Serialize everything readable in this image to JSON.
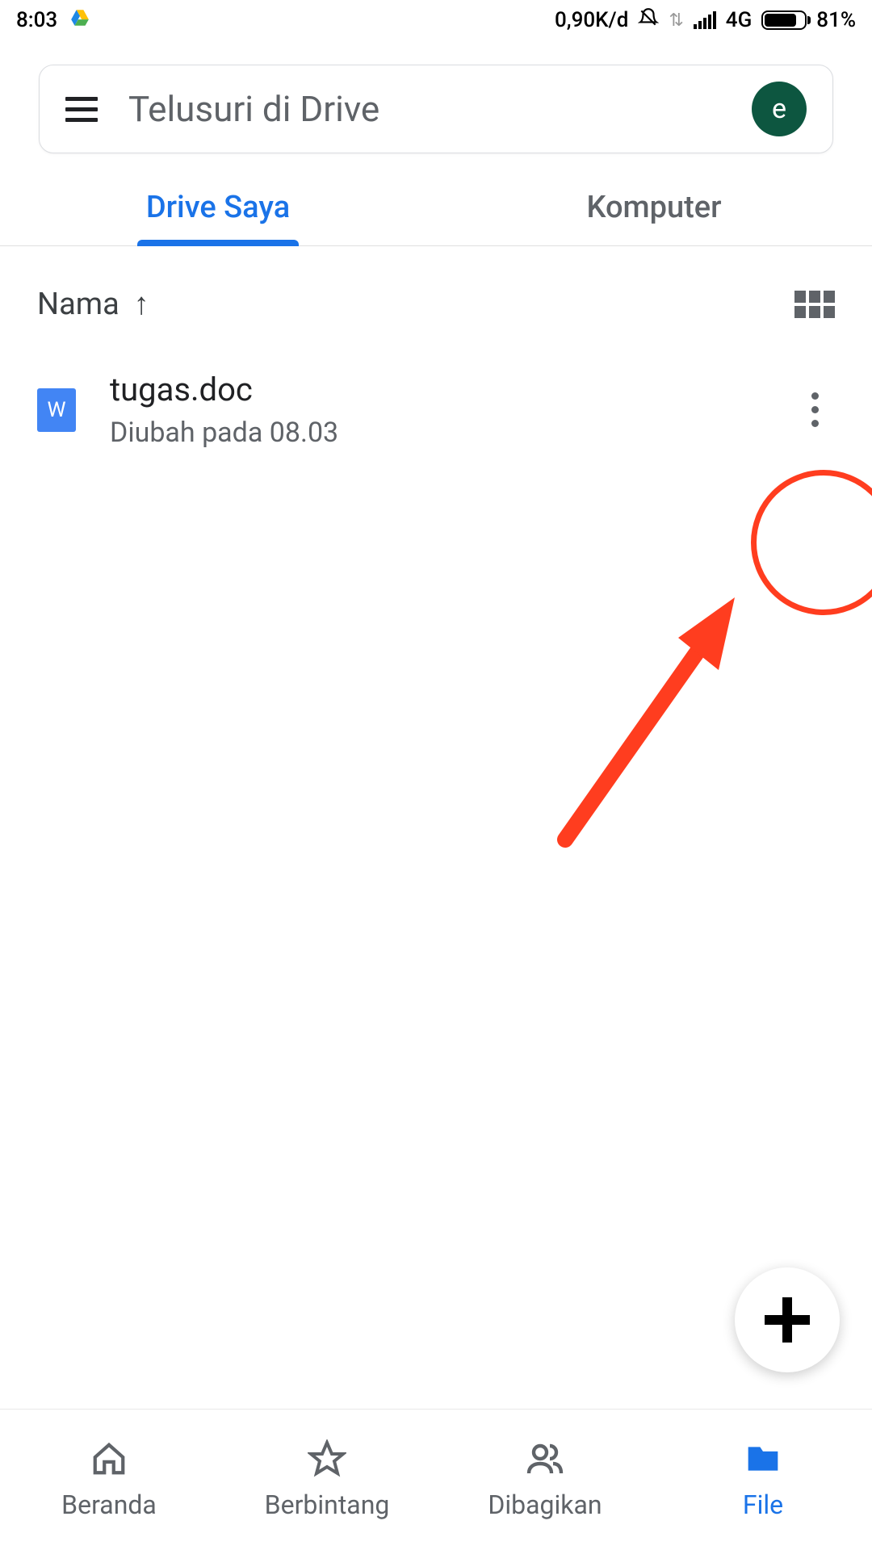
{
  "status_bar": {
    "time": "8:03",
    "data_rate": "0,90K/d",
    "network_type": "4G",
    "battery_pct": "81%"
  },
  "search": {
    "placeholder": "Telusuri di Drive",
    "avatar_letter": "e"
  },
  "tabs": [
    {
      "label": "Drive Saya",
      "active": true
    },
    {
      "label": "Komputer",
      "active": false
    }
  ],
  "sort": {
    "label": "Nama",
    "direction_icon": "↑"
  },
  "files": [
    {
      "name": "tugas.doc",
      "meta": "Diubah pada 08.03",
      "icon_letter": "W"
    }
  ],
  "bottom_nav": [
    {
      "label": "Beranda",
      "icon": "home",
      "active": false
    },
    {
      "label": "Berbintang",
      "icon": "star",
      "active": false
    },
    {
      "label": "Dibagikan",
      "icon": "shared",
      "active": false
    },
    {
      "label": "File",
      "icon": "folder",
      "active": true
    }
  ]
}
